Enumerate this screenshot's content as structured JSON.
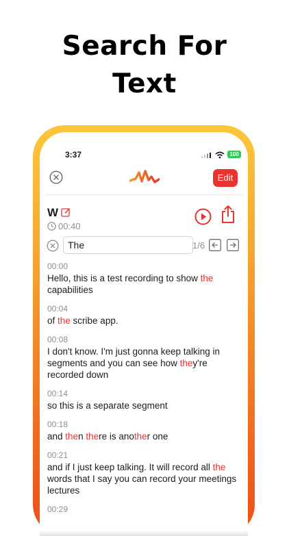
{
  "headline": {
    "line1": "Search For",
    "line2": "Text"
  },
  "status_bar": {
    "time": "3:37",
    "battery": "100"
  },
  "toolbar": {
    "edit_label": "Edit"
  },
  "recording": {
    "title": "W",
    "duration": "00:40"
  },
  "search": {
    "value": "The",
    "match_count": "1/6"
  },
  "colors": {
    "accent": "#e8332e",
    "frame_top": "#fdc73a",
    "frame_bottom": "#ee4e18"
  },
  "icons": [
    "close-circle-icon",
    "waveform-logo-icon",
    "edit-pencil-icon",
    "clock-icon",
    "play-icon",
    "share-icon",
    "clear-icon",
    "arrow-left-icon",
    "arrow-right-icon"
  ],
  "segments": [
    {
      "time": "00:00",
      "parts": [
        {
          "t": "Hello, this is a test recording to show "
        },
        {
          "t": "the",
          "hl": true
        },
        {
          "t": " capabilities"
        }
      ]
    },
    {
      "time": "00:04",
      "parts": [
        {
          "t": "of "
        },
        {
          "t": "the",
          "hl": true
        },
        {
          "t": " scribe app."
        }
      ]
    },
    {
      "time": "00:08",
      "parts": [
        {
          "t": "I don't know. I'm just gonna keep talking in segments and you can see how "
        },
        {
          "t": "the",
          "hl": true
        },
        {
          "t": "y're recorded down"
        }
      ]
    },
    {
      "time": "00:14",
      "parts": [
        {
          "t": "so this is a separate segment"
        }
      ]
    },
    {
      "time": "00:18",
      "parts": [
        {
          "t": "and "
        },
        {
          "t": "the",
          "hl": true
        },
        {
          "t": "n "
        },
        {
          "t": "the",
          "hl": true
        },
        {
          "t": "re is ano"
        },
        {
          "t": "the",
          "hl": true
        },
        {
          "t": "r one"
        }
      ]
    },
    {
      "time": "00:21",
      "parts": [
        {
          "t": "and if I just keep talking. It will record all "
        },
        {
          "t": "the",
          "hl": true
        },
        {
          "t": " words that I say you can record your meetings lectures"
        }
      ]
    },
    {
      "time": "00:29",
      "parts": []
    }
  ]
}
